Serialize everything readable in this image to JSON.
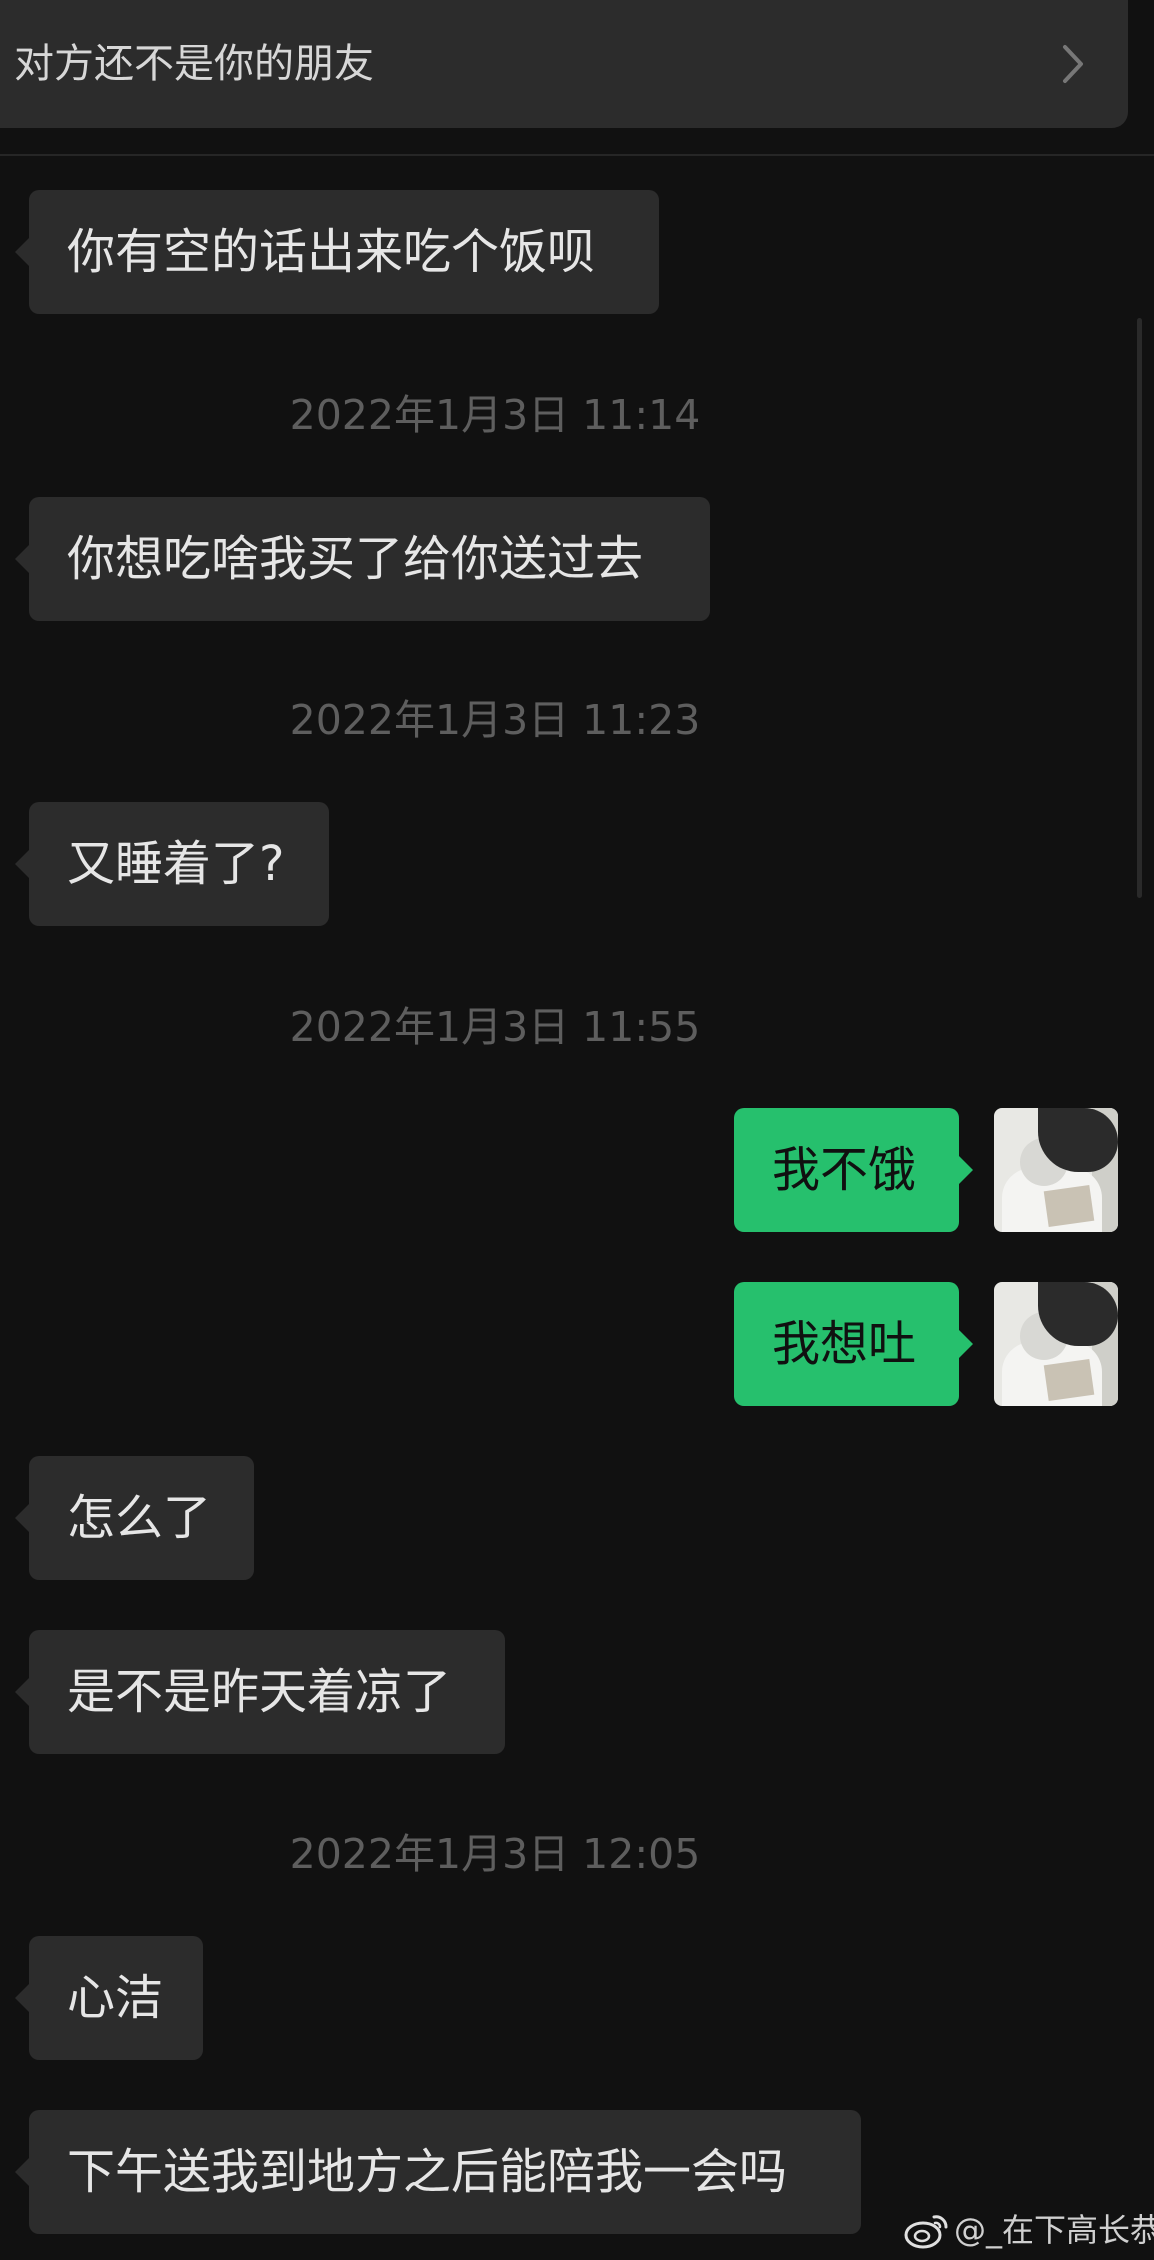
{
  "notice": {
    "text": "对方还不是你的朋友",
    "icon": "chevron-right-icon"
  },
  "messages": [
    {
      "type": "in",
      "text": "你有空的话出来吃个饭呗"
    },
    {
      "type": "time",
      "text": "2022年1月3日 11:14"
    },
    {
      "type": "in",
      "text": "你想吃啥我买了给你送过去"
    },
    {
      "type": "time",
      "text": "2022年1月3日 11:23"
    },
    {
      "type": "in",
      "text": "又睡着了?"
    },
    {
      "type": "time",
      "text": "2022年1月3日 11:55"
    },
    {
      "type": "out",
      "text": "我不饿"
    },
    {
      "type": "out",
      "text": "我想吐"
    },
    {
      "type": "in",
      "text": "怎么了"
    },
    {
      "type": "in",
      "text": "是不是昨天着凉了"
    },
    {
      "type": "time",
      "text": "2022年1月3日 12:05"
    },
    {
      "type": "in",
      "text": "心洁"
    },
    {
      "type": "in",
      "text": "下午送我到地方之后能陪我一会吗"
    }
  ],
  "watermark": {
    "text": "@_在下高长恭",
    "icon": "weibo-icon"
  },
  "colors": {
    "background": "#111111",
    "incoming_bubble": "#2c2c2c",
    "outgoing_bubble": "#26c06d",
    "timestamp": "#5e5e5e"
  }
}
